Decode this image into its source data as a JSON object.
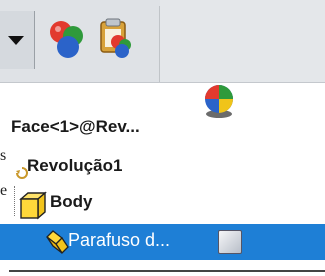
{
  "tree": {
    "face_label": "Face<1>@Rev...",
    "revolve_label": "Revolução1",
    "body_label": "Body",
    "selected_label": "Parafuso d...",
    "cutoff_chars": [
      "s",
      "e"
    ]
  },
  "colors": {
    "selection": "#1e7fd6",
    "toolbar": "#dfe2e6"
  }
}
